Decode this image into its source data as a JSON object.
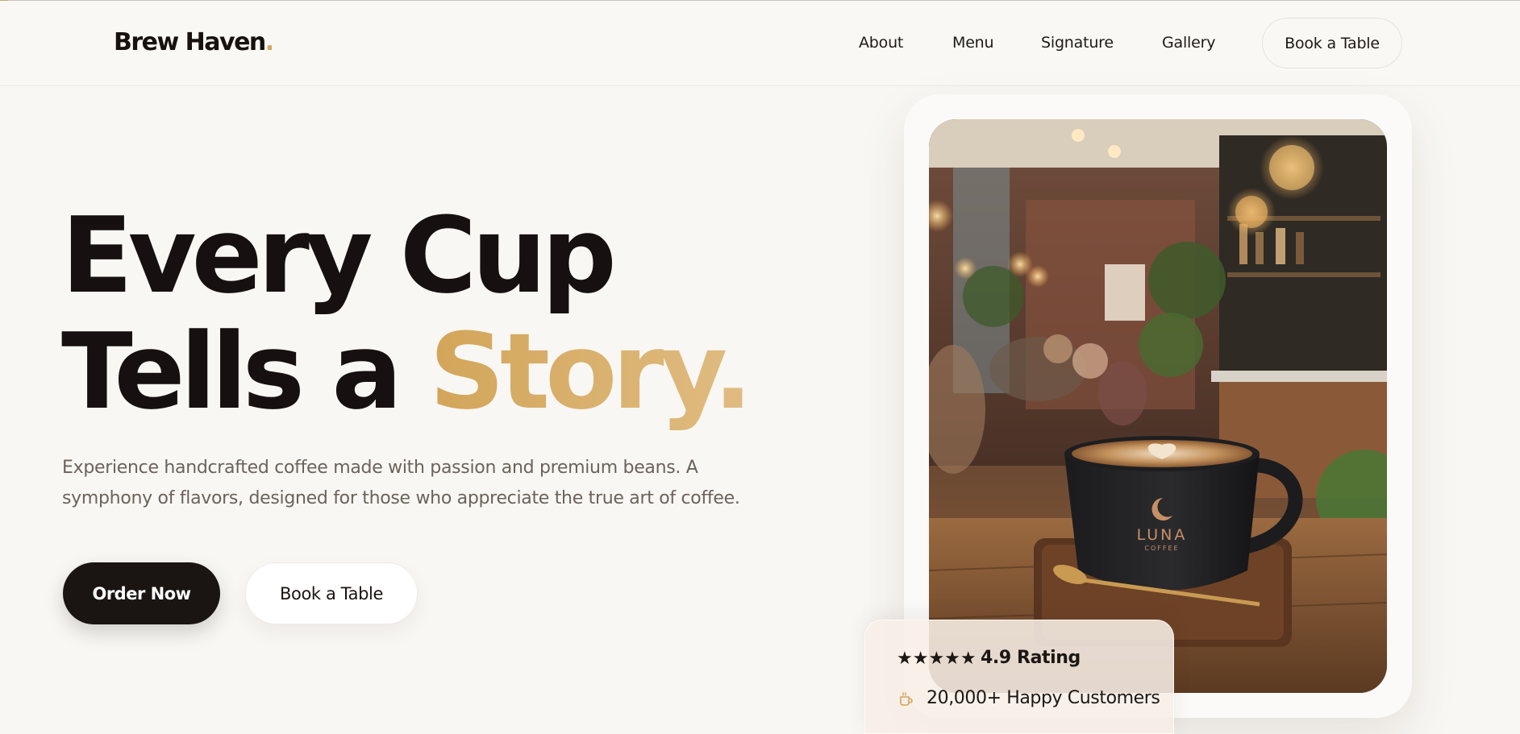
{
  "brand": {
    "name": "Brew Haven",
    "dot": ".",
    "accent_color": "#d3aa5c"
  },
  "nav": {
    "links": [
      "About",
      "Menu",
      "Signature",
      "Gallery"
    ],
    "cta": "Book a Table"
  },
  "hero": {
    "line1": "Every Cup",
    "line2_prefix": "Tells a ",
    "line2_accent": "Story.",
    "subtext": "Experience handcrafted coffee made with passion and premium beans. A symphony of flavors, designed for those who appreciate the true art of coffee.",
    "primary_button": "Order Now",
    "secondary_button": "Book a Table"
  },
  "photo": {
    "cup_brand": "LUNA",
    "cup_sub": "COFFEE"
  },
  "rating_card": {
    "stars": "★★★★★",
    "rating": "4.9 Rating",
    "customers": "20,000+ Happy Customers",
    "stars_icon": "star-icon",
    "customers_icon": "coffee-cup-icon"
  },
  "colors": {
    "background": "#f9f7f4",
    "text": "#171210",
    "primary_button": "#1a1412",
    "gold": "#d2a559"
  }
}
